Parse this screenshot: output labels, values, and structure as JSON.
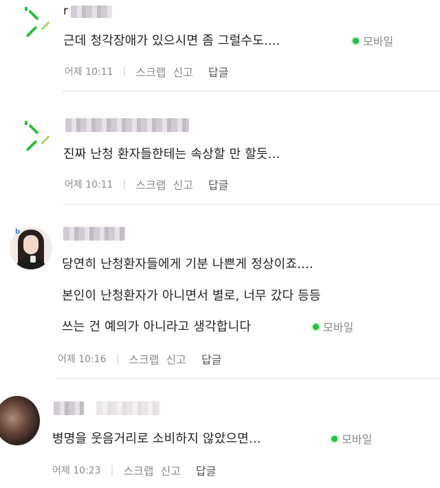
{
  "comments": [
    {
      "name_visible": "r",
      "lines": [
        "근데 청각장애가 있으시면 좀 그럴수도...."
      ],
      "mobile": "모바일",
      "time": "어제 10:11",
      "scrap": "스크랩",
      "report": "신고",
      "reply": "답글"
    },
    {
      "lines": [
        "진짜 난청 환자들한테는 속상할 만 할듯..."
      ],
      "time": "어제 10:11",
      "scrap": "스크랩",
      "report": "신고",
      "reply": "답글"
    },
    {
      "badge": "b",
      "lines": [
        "당연히 난청환자들에게 기분 나쁜게 정상이죠....",
        "본인이 난청환자가 아니면서 별로, 너무 갔다 등등",
        "쓰는 건 예의가 아니라고 생각합니다"
      ],
      "mobile": "모바일",
      "time": "어제 10:16",
      "scrap": "스크랩",
      "report": "신고",
      "reply": "답글"
    },
    {
      "lines": [
        "병명을 웃음거리로 소비하지 않았으면..."
      ],
      "mobile": "모바일",
      "time": "어제 10:23",
      "scrap": "스크랩",
      "report": "신고",
      "reply": "답글"
    }
  ],
  "colors": {
    "mobile_dot": "#20c040",
    "avatar_green": "#2fbf3c"
  }
}
